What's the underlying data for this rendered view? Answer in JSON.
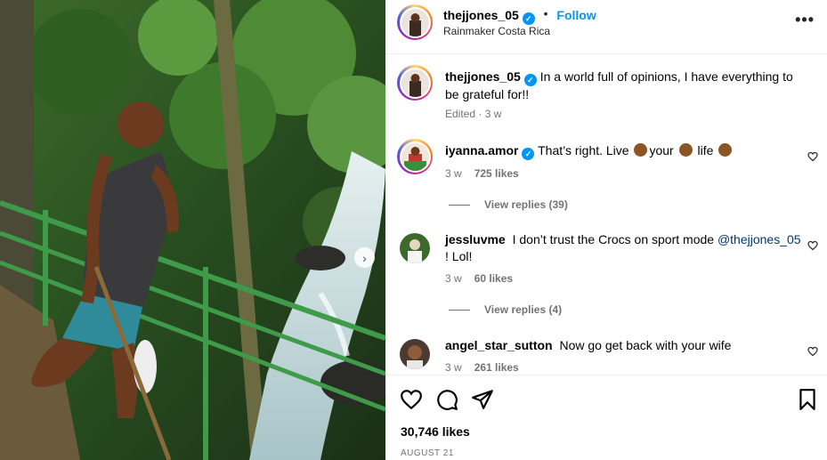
{
  "post": {
    "author": "thejjones_05",
    "location": "Rainmaker Costa Rica",
    "follow_label": "Follow",
    "separator": "•",
    "more_label": "•••",
    "caption": "In a world full of opinions, I have everything to be grateful for!!",
    "caption_meta": "Edited · 3 w",
    "likes": "30,746 likes",
    "date": "AUGUST 21"
  },
  "comments": [
    {
      "username": "iyanna.amor",
      "verified": true,
      "text_parts": [
        "That’s right. Live",
        "your",
        "life"
      ],
      "time": "3 w",
      "likes": "725 likes",
      "replies": "View replies (39)"
    },
    {
      "username": "jessluvme",
      "verified": false,
      "text": "I don’t trust the Crocs on sport mode",
      "mention": "@thejjones_05",
      "text_end": "! Lol!",
      "time": "3 w",
      "likes": "60 likes",
      "replies": "View replies (4)"
    },
    {
      "username": "angel_star_sutton",
      "verified": false,
      "text": "Now go get back with your wife",
      "time": "3 w",
      "likes": "261 likes"
    }
  ],
  "icons": {
    "like": "heart-icon",
    "comment": "comment-icon",
    "share": "share-icon",
    "save": "bookmark-icon",
    "next": "chevron-right-icon",
    "verified": "verified-badge-icon"
  },
  "colors": {
    "accent": "#0095f6",
    "mention": "#00376b",
    "meta": "#737373"
  }
}
